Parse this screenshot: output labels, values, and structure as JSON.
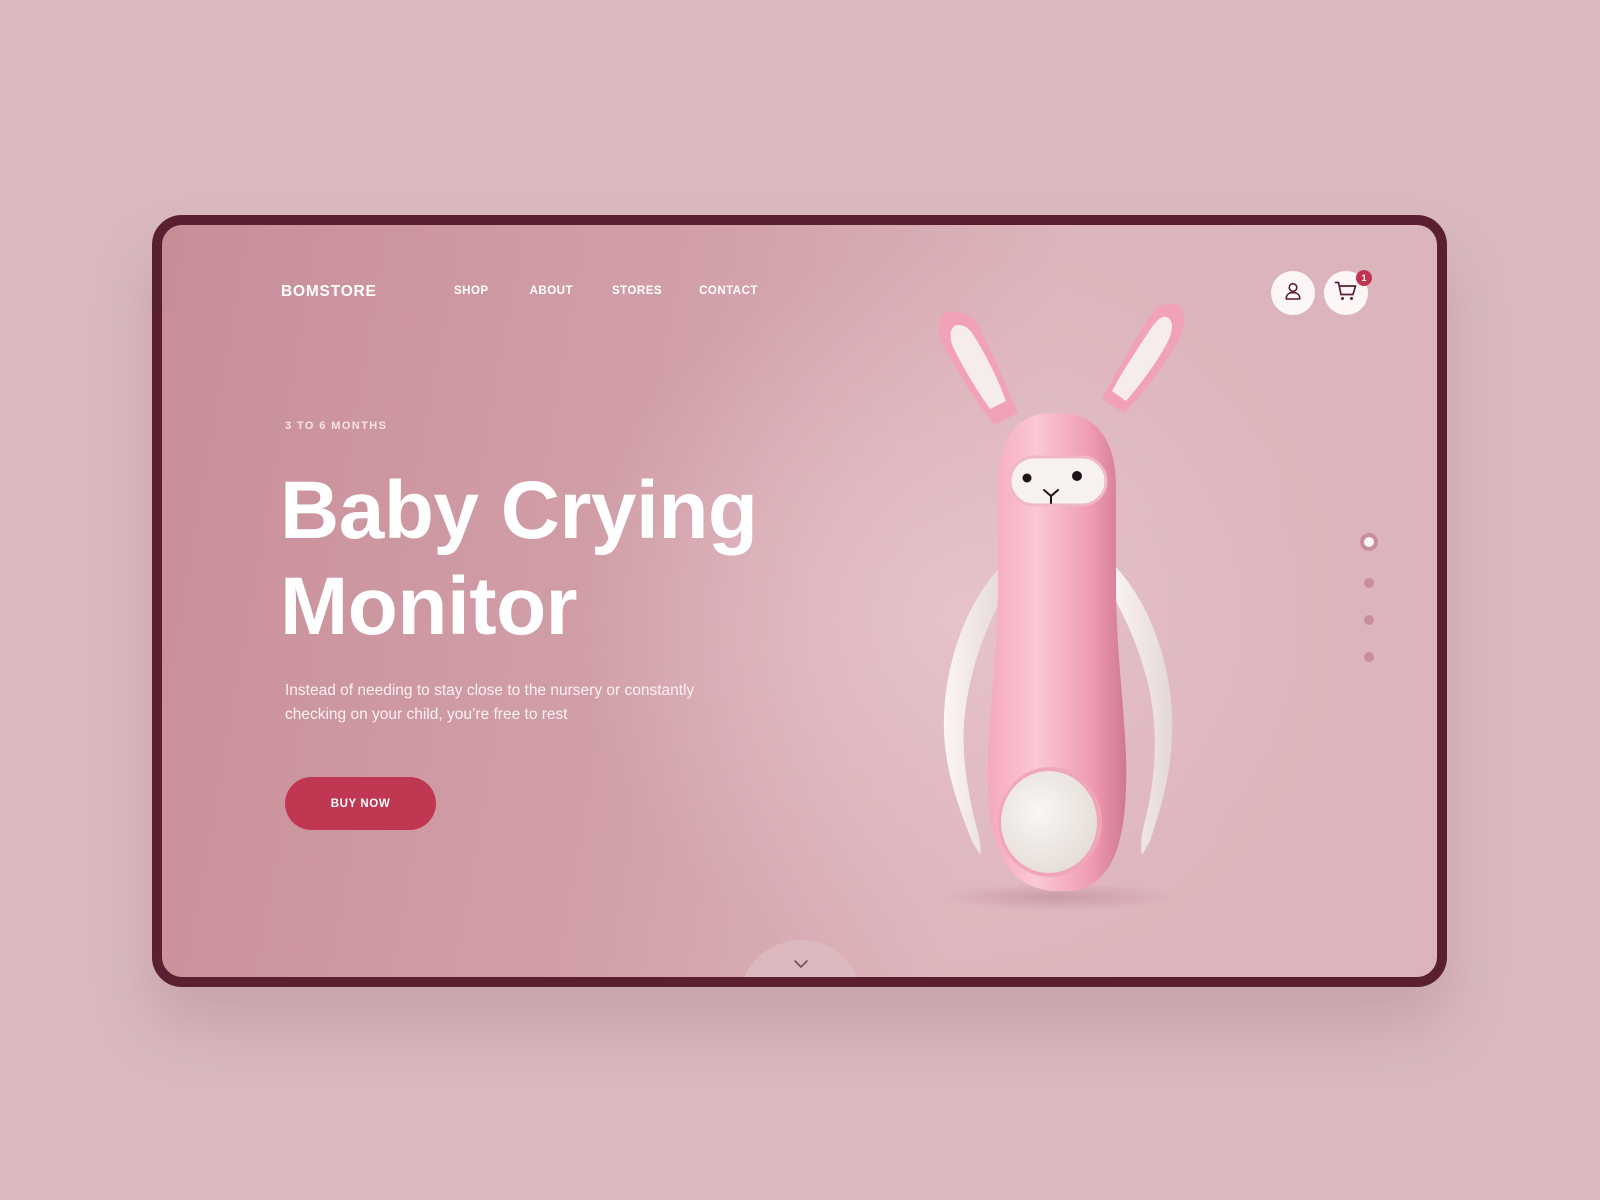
{
  "brand": {
    "logo": "BOMSTORE"
  },
  "nav": {
    "items": [
      {
        "label": "SHOP"
      },
      {
        "label": "ABOUT"
      },
      {
        "label": "STORES"
      },
      {
        "label": "CONTACT"
      }
    ]
  },
  "header_actions": {
    "user_icon": "user-icon",
    "cart_icon": "cart-icon",
    "cart_count": "1"
  },
  "hero": {
    "eyebrow": "3 TO 6 MONTHS",
    "title_line1": "Baby Crying",
    "title_line2": "Monitor",
    "description_line1": "Instead of needing to stay close to the nursery or constantly",
    "description_line2": "checking on your child, you’re free to rest",
    "cta_label": "BUY NOW"
  },
  "slider": {
    "count": 4,
    "active_index": 0
  },
  "scroll_indicator": {
    "icon": "chevron-down-icon"
  },
  "colors": {
    "page_bg": "#d9b9bf",
    "frame": "#5a1f31",
    "accent": "#bf3751",
    "product_pink": "#f2a9bd",
    "product_white": "#f4eeec"
  }
}
